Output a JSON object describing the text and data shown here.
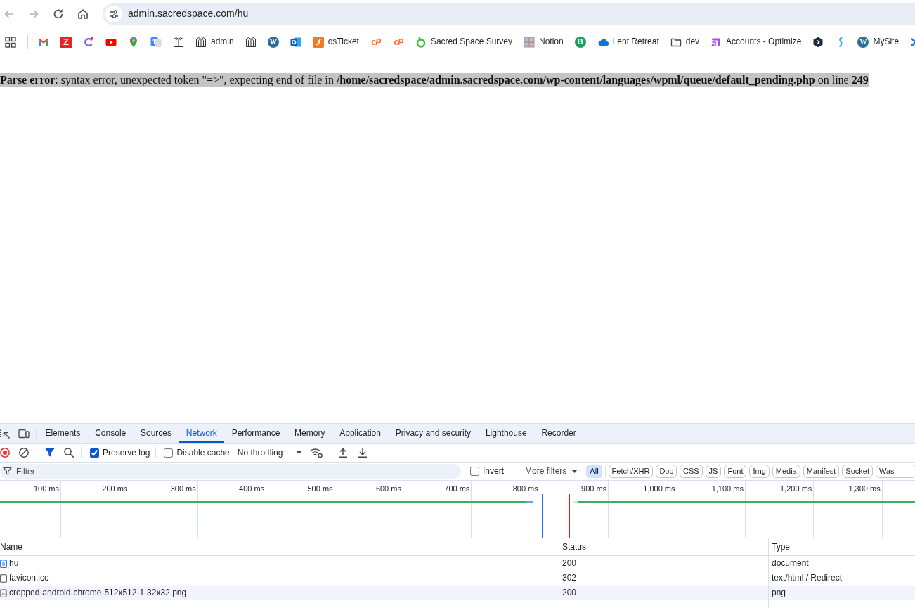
{
  "browser": {
    "nav": [
      {
        "kind": "back",
        "disabled": true
      },
      {
        "kind": "forward",
        "disabled": true
      },
      {
        "kind": "reload",
        "disabled": false
      },
      {
        "kind": "home",
        "disabled": false
      }
    ],
    "address": {
      "url": "admin.sacredspace.com/hu"
    }
  },
  "bookmarks": [
    {
      "kind": "mail"
    },
    {
      "kind": "zoho",
      "glyph": "Z"
    },
    {
      "kind": "clickup"
    },
    {
      "kind": "video"
    },
    {
      "kind": "pin"
    },
    {
      "kind": "translate"
    },
    {
      "kind": "arch"
    },
    {
      "kind": "arch",
      "label": "admin"
    },
    {
      "kind": "arch"
    },
    {
      "kind": "wordpress",
      "glyph": "W"
    },
    {
      "kind": "outlook"
    },
    {
      "kind": "kangaroo",
      "label": "osTicket"
    },
    {
      "kind": "cpanel",
      "glyph": "cP"
    },
    {
      "kind": "cpanel",
      "glyph": "cP"
    },
    {
      "kind": "survey",
      "label": "Sacred Space Survey"
    },
    {
      "kind": "panes",
      "label": "Notion"
    },
    {
      "kind": "bubble",
      "glyph": "B"
    },
    {
      "kind": "cloud",
      "label": "Lent Retreat"
    },
    {
      "kind": "folder",
      "label": "dev"
    },
    {
      "kind": "optimize",
      "label": "Accounts - Optimize"
    },
    {
      "kind": "hexagon"
    },
    {
      "kind": "wave"
    },
    {
      "kind": "wordpress",
      "glyph": "W",
      "label": "MySite"
    },
    {
      "kind": "partial"
    }
  ],
  "page": {
    "error": {
      "text": "**Parse error**: syntax error, unexpected token \"=>\", expecting end of file in **/home/sacredspace/admin.sacredspace.com/wp-content/languages/wpml/queue/default_pending.php** on line **249**",
      "selected": true
    }
  },
  "devtools": {
    "tabs": [
      {
        "label": "Elements",
        "selected": false
      },
      {
        "label": "Console",
        "selected": false
      },
      {
        "label": "Sources",
        "selected": false
      },
      {
        "label": "Network",
        "selected": true
      },
      {
        "label": "Performance",
        "selected": false
      },
      {
        "label": "Memory",
        "selected": false
      },
      {
        "label": "Application",
        "selected": false
      },
      {
        "label": "Privacy and security",
        "selected": false
      },
      {
        "label": "Lighthouse",
        "selected": false
      },
      {
        "label": "Recorder",
        "selected": false
      }
    ],
    "toolbar": {
      "preserve_log": {
        "label": "Preserve log",
        "checked": true
      },
      "disable_cache": {
        "label": "Disable cache",
        "checked": false
      },
      "throttling": "No throttling"
    },
    "filter": {
      "placeholder": "Filter",
      "invert": {
        "label": "Invert",
        "checked": false
      },
      "more_filters": "More filters",
      "chips": [
        {
          "label": "All",
          "selected": true
        },
        {
          "label": "Fetch/XHR",
          "selected": false
        },
        {
          "label": "Doc",
          "selected": false
        },
        {
          "label": "CSS",
          "selected": false
        },
        {
          "label": "JS",
          "selected": false
        },
        {
          "label": "Font",
          "selected": false
        },
        {
          "label": "Img",
          "selected": false
        },
        {
          "label": "Media",
          "selected": false
        },
        {
          "label": "Manifest",
          "selected": false
        },
        {
          "label": "Socket",
          "selected": false
        },
        {
          "label": "Was",
          "selected": false
        }
      ]
    },
    "timeline": {
      "ticks": [
        "100 ms",
        "200 ms",
        "300 ms",
        "400 ms",
        "500 ms",
        "600 ms",
        "700 ms",
        "800 ms",
        "900 ms",
        "1,000 ms",
        "1,100 ms",
        "1,200 ms",
        "1,300 ms"
      ]
    },
    "table": {
      "columns": [
        "Name",
        "Status",
        "Type"
      ],
      "rows": [
        {
          "kind": "document",
          "name": "hu",
          "status": "200",
          "type": "document"
        },
        {
          "kind": "blank",
          "name": "favicon.ico",
          "status": "302",
          "type": "text/html / Redirect"
        },
        {
          "kind": "image",
          "name": "cropped-android-chrome-512x512-1-32x32.png",
          "status": "200",
          "type": "png"
        }
      ]
    }
  }
}
